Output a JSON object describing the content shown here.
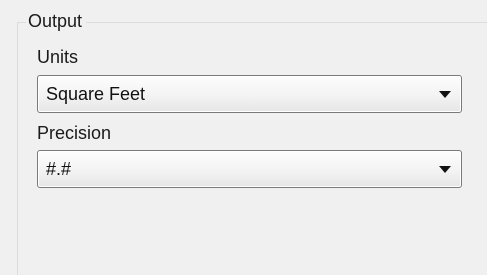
{
  "output_group": {
    "title": "Output",
    "units": {
      "label": "Units",
      "selected": "Square Feet"
    },
    "precision": {
      "label": "Precision",
      "selected": "#.#"
    }
  },
  "icons": {
    "dropdown": "chevron-down-icon"
  }
}
